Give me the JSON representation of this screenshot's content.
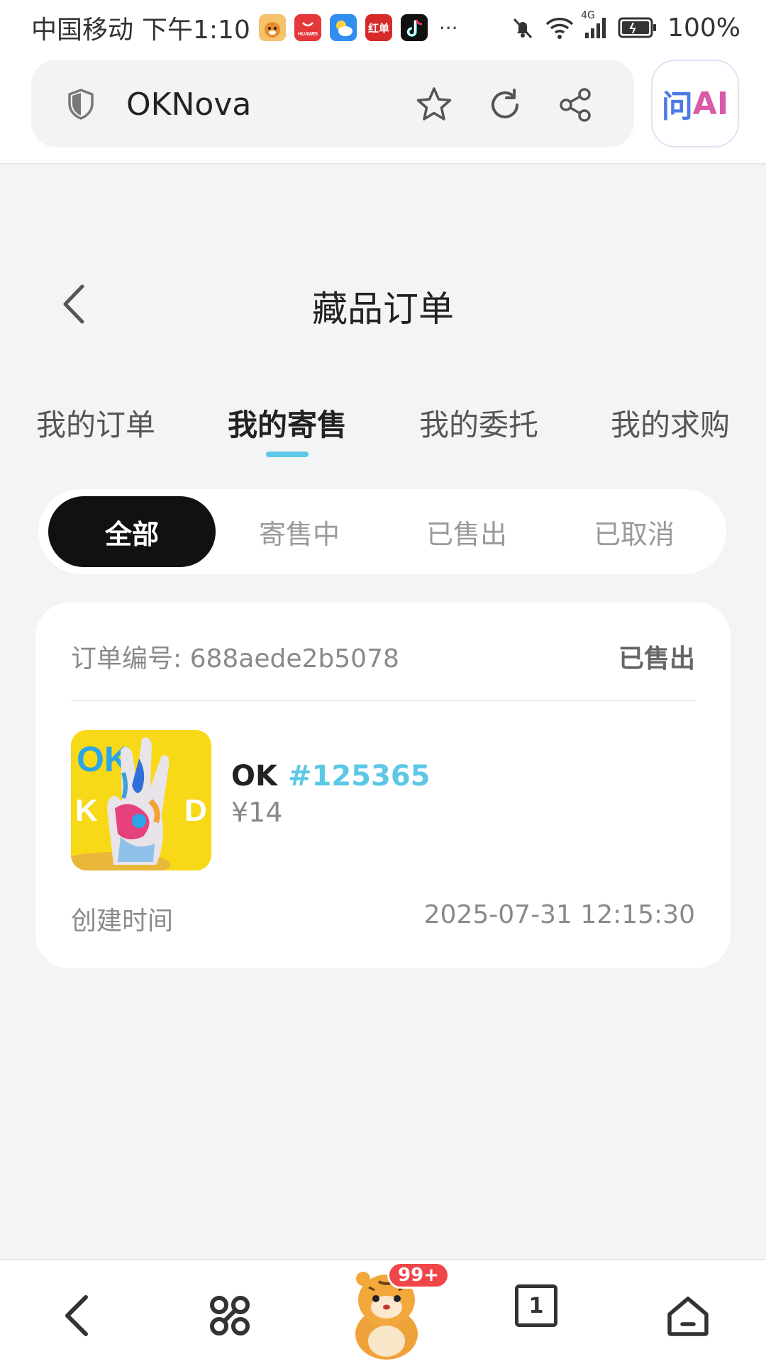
{
  "status_bar": {
    "carrier": "中国移动",
    "time": "下午1:10",
    "app_icons": [
      {
        "name": "hamster-app-icon",
        "color": "#f2a33a"
      },
      {
        "name": "huawei-appgallery-icon",
        "color": "#e5383b",
        "text": "HUAWEI"
      },
      {
        "name": "weather-icon",
        "color": "#2f8ef0"
      },
      {
        "name": "hongdan-app-icon",
        "color": "#d62a2a",
        "text": "红单"
      },
      {
        "name": "tiktok-icon",
        "color": "#111111"
      }
    ],
    "more": "···",
    "network": "4G",
    "battery": "100%"
  },
  "browser": {
    "url": "OKNova",
    "ai_label_prefix": "问",
    "ai_label_suffix": "AI"
  },
  "page": {
    "title": "藏品订单"
  },
  "tabs": [
    {
      "label": "我的订单",
      "active": false
    },
    {
      "label": "我的寄售",
      "active": true
    },
    {
      "label": "我的委托",
      "active": false
    },
    {
      "label": "我的求购",
      "active": false
    }
  ],
  "filters": [
    {
      "label": "全部",
      "active": true
    },
    {
      "label": "寄售中",
      "active": false
    },
    {
      "label": "已售出",
      "active": false
    },
    {
      "label": "已取消",
      "active": false
    }
  ],
  "order": {
    "order_no_label": "订单编号:",
    "order_no": "688aede2b5078",
    "status": "已售出",
    "item_name": "OK",
    "item_id": "#125365",
    "price": "¥14",
    "created_label": "创建时间",
    "created_value": "2025-07-31 12:15:30"
  },
  "bottom_nav": {
    "badge": "99+",
    "tab_count": "1"
  },
  "colors": {
    "accent": "#5cc8e6",
    "page_bg": "#f3f4f6",
    "active_filter_bg": "#111111",
    "badge": "#f0464a"
  }
}
